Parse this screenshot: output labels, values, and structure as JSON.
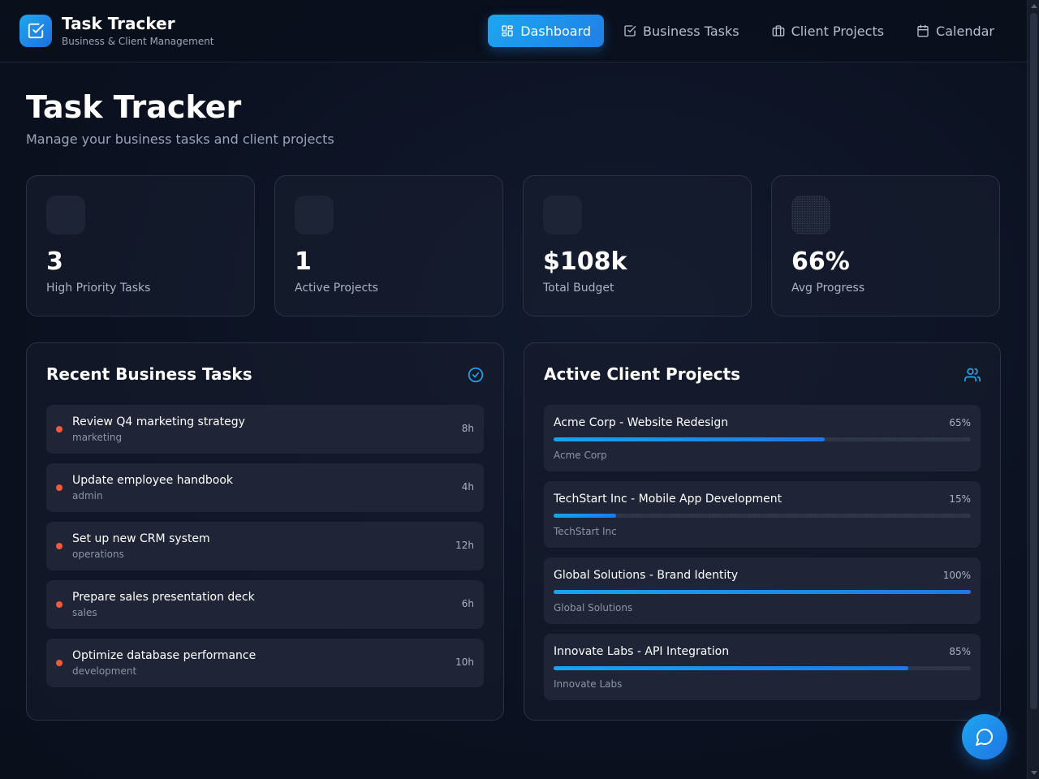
{
  "header": {
    "brand_title": "Task Tracker",
    "brand_subtitle": "Business & Client Management",
    "logo_icon": "checkbox-icon",
    "nav": [
      {
        "label": "Dashboard",
        "icon": "grid-icon",
        "active": true
      },
      {
        "label": "Business Tasks",
        "icon": "checkbox-icon",
        "active": false
      },
      {
        "label": "Client Projects",
        "icon": "briefcase-icon",
        "active": false
      },
      {
        "label": "Calendar",
        "icon": "calendar-icon",
        "active": false
      }
    ]
  },
  "page": {
    "title": "Task Tracker",
    "subtitle": "Manage your business tasks and client projects"
  },
  "stats": [
    {
      "value": "3",
      "label": "High Priority Tasks"
    },
    {
      "value": "1",
      "label": "Active Projects"
    },
    {
      "value": "$108k",
      "label": "Total Budget"
    },
    {
      "value": "66%",
      "label": "Avg Progress"
    }
  ],
  "tasks_panel": {
    "title": "Recent Business Tasks",
    "icon": "check-circle-icon",
    "tasks": [
      {
        "title": "Review Q4 marketing strategy",
        "category": "marketing",
        "hours": "8h"
      },
      {
        "title": "Update employee handbook",
        "category": "admin",
        "hours": "4h"
      },
      {
        "title": "Set up new CRM system",
        "category": "operations",
        "hours": "12h"
      },
      {
        "title": "Prepare sales presentation deck",
        "category": "sales",
        "hours": "6h"
      },
      {
        "title": "Optimize database performance",
        "category": "development",
        "hours": "10h"
      }
    ]
  },
  "projects_panel": {
    "title": "Active Client Projects",
    "icon": "users-icon",
    "projects": [
      {
        "name": "Acme Corp - Website Redesign",
        "percent_label": "65%",
        "progress": 65,
        "client": "Acme Corp"
      },
      {
        "name": "TechStart Inc - Mobile App Development",
        "percent_label": "15%",
        "progress": 15,
        "client": "TechStart Inc"
      },
      {
        "name": "Global Solutions - Brand Identity",
        "percent_label": "100%",
        "progress": 100,
        "client": "Global Solutions"
      },
      {
        "name": "Innovate Labs - API Integration",
        "percent_label": "85%",
        "progress": 85,
        "client": "Innovate Labs"
      }
    ]
  },
  "colors": {
    "accent": "#1ea7f0",
    "priority_dot": "#ef5a3c",
    "background": "#0b1120"
  },
  "chat_button": {
    "icon": "chat-bubble-icon"
  }
}
